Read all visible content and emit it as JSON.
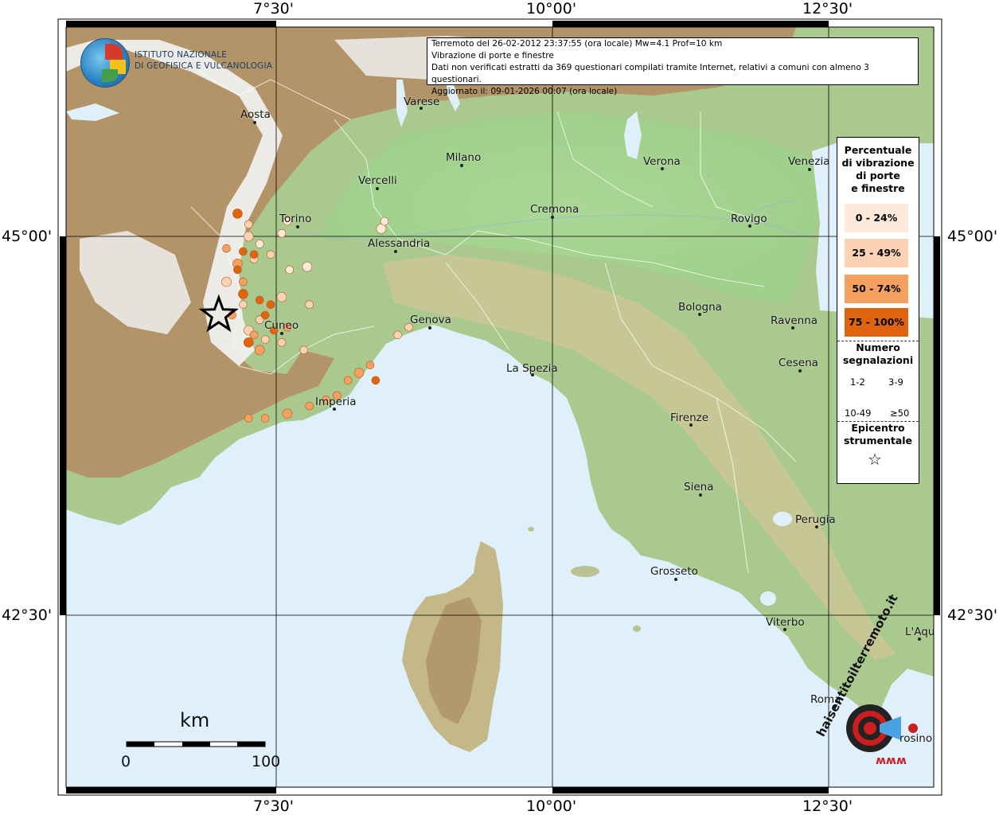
{
  "coords": {
    "top": [
      "7°30'",
      "10°00'",
      "12°30'"
    ],
    "bottom": [
      "7°30'",
      "10°00'",
      "12°30'"
    ],
    "left": [
      "45°00'",
      "42°30'"
    ],
    "right": [
      "45°00'",
      "42°30'"
    ]
  },
  "logo": {
    "line1": "ISTITUTO NAZIONALE",
    "line2": "DI GEOFISICA E VULCANOLOGIA"
  },
  "info": {
    "line1": "Terremoto del 26-02-2012 23:37:55 (ora locale) Mw=4.1 Prof=10 km",
    "line2": "Vibrazione di porte e finestre",
    "line3": "Dati non verificati estratti da 369 questionari compilati tramite Internet, relativi a comuni con almeno 3 questionari.",
    "line4": "Aggiornato il: 09-01-2026 00:07 (ora locale)"
  },
  "cities": [
    {
      "id": "aosta",
      "name": "Aosta"
    },
    {
      "id": "varese",
      "name": "Varese"
    },
    {
      "id": "milano",
      "name": "Milano"
    },
    {
      "id": "verona",
      "name": "Verona"
    },
    {
      "id": "venezia",
      "name": "Venezia"
    },
    {
      "id": "vercelli",
      "name": "Vercelli"
    },
    {
      "id": "torino",
      "name": "Torino"
    },
    {
      "id": "cremona",
      "name": "Cremona"
    },
    {
      "id": "rovigo",
      "name": "Rovigo"
    },
    {
      "id": "alessandria",
      "name": "Alessandria"
    },
    {
      "id": "bologna",
      "name": "Bologna"
    },
    {
      "id": "ravenna",
      "name": "Ravenna"
    },
    {
      "id": "cuneo",
      "name": "Cuneo"
    },
    {
      "id": "genova",
      "name": "Genova"
    },
    {
      "id": "cesena",
      "name": "Cesena"
    },
    {
      "id": "laspezia",
      "name": "La Spezia"
    },
    {
      "id": "imperia",
      "name": "Imperia"
    },
    {
      "id": "firenze",
      "name": "Firenze"
    },
    {
      "id": "siena",
      "name": "Siena"
    },
    {
      "id": "perugia",
      "name": "Perugia"
    },
    {
      "id": "grosseto",
      "name": "Grosseto"
    },
    {
      "id": "viterbo",
      "name": "Viterbo"
    },
    {
      "id": "laquila",
      "name": "L'Aqu"
    },
    {
      "id": "roma",
      "name": "Roma"
    },
    {
      "id": "frosinone",
      "name": "rosino"
    }
  ],
  "legend": {
    "title": [
      "Percentuale",
      "di vibrazione",
      "di porte",
      "e finestre"
    ],
    "classes": [
      {
        "label": "0 - 24%",
        "color": "#fde9d9"
      },
      {
        "label": "25 - 49%",
        "color": "#fbd2b3"
      },
      {
        "label": "50 - 74%",
        "color": "#f4a05f"
      },
      {
        "label": "75 - 100%",
        "color": "#e0640f"
      }
    ],
    "count_title": [
      "Numero",
      "segnalazioni"
    ],
    "counts": [
      "1-2",
      "3-9",
      "10-49",
      "≥50"
    ],
    "epicenter_title": [
      "Epicentro",
      "strumentale"
    ]
  },
  "scalebar": {
    "unit": "km",
    "min": "0",
    "max": "100"
  },
  "watermark": {
    "text": "haisentitoilterremoto.it",
    "url": "www"
  },
  "colors": {
    "sea": "#dff0fa",
    "lowland": "#9ecd8a",
    "hills": "#c9c896",
    "mountains": "#ad8e66",
    "snow": "#f4f4f4"
  },
  "chart_data": {
    "type": "scatter",
    "series": [
      {
        "class": 0,
        "values": [
          [
            8.45,
            45.05
          ],
          [
            8.48,
            45.1
          ],
          [
            7.55,
            45.02
          ],
          [
            7.62,
            44.78
          ],
          [
            7.78,
            44.8
          ],
          [
            7.6,
            45.1
          ],
          [
            7.35,
            44.95
          ]
        ]
      },
      {
        "class": 1,
        "values": [
          [
            7.25,
            45.0
          ],
          [
            7.45,
            44.88
          ],
          [
            7.25,
            45.08
          ],
          [
            7.3,
            44.85
          ],
          [
            7.55,
            44.6
          ],
          [
            7.8,
            44.55
          ],
          [
            7.35,
            44.45
          ],
          [
            7.2,
            44.55
          ],
          [
            7.25,
            44.38
          ],
          [
            7.4,
            44.32
          ],
          [
            7.55,
            44.3
          ],
          [
            7.75,
            44.25
          ],
          [
            7.05,
            44.7
          ],
          [
            8.7,
            44.4
          ],
          [
            8.6,
            44.35
          ]
        ]
      },
      {
        "class": 2,
        "values": [
          [
            7.15,
            44.82
          ],
          [
            7.2,
            44.7
          ],
          [
            7.05,
            44.92
          ],
          [
            7.1,
            44.48
          ],
          [
            7.35,
            44.25
          ],
          [
            8.05,
            43.95
          ],
          [
            7.95,
            43.92
          ],
          [
            7.8,
            43.88
          ],
          [
            7.6,
            43.83
          ],
          [
            7.4,
            43.8
          ],
          [
            7.25,
            43.8
          ],
          [
            8.15,
            44.05
          ],
          [
            8.25,
            44.1
          ],
          [
            8.35,
            44.15
          ],
          [
            7.6,
            44.4
          ],
          [
            7.3,
            44.35
          ]
        ]
      },
      {
        "class": 3,
        "values": [
          [
            7.15,
            45.15
          ],
          [
            7.2,
            44.9
          ],
          [
            7.3,
            44.88
          ],
          [
            7.15,
            44.78
          ],
          [
            7.2,
            44.62
          ],
          [
            7.35,
            44.58
          ],
          [
            7.45,
            44.55
          ],
          [
            7.4,
            44.48
          ],
          [
            7.25,
            44.3
          ],
          [
            8.4,
            44.05
          ],
          [
            7.48,
            44.38
          ]
        ]
      }
    ],
    "epicenter": [
      6.98,
      44.48
    ]
  }
}
